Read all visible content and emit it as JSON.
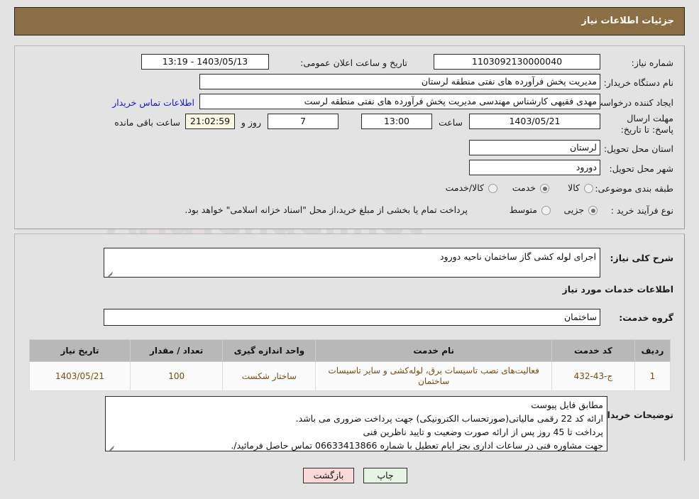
{
  "header": {
    "title": "جزئیات اطلاعات نیاز"
  },
  "main_form": {
    "need_number_label": "شماره نیاز:",
    "need_number_value": "1103092130000040",
    "announce_label": "تاریخ و ساعت اعلان عمومی:",
    "announce_value": "1403/05/13 - 13:19",
    "buyer_org_label": "نام دستگاه خریدار:",
    "buyer_org_value": "مدیریت پخش فرآورده های نفتی منطقه لرستان",
    "requester_label": "ایجاد کننده درخواست:",
    "requester_value": "مهدی فقیهی کارشناس مهندسی مدیریت پخش فرآورده های نفتی منطقه لرست",
    "contact_link": "اطلاعات تماس خریدار",
    "deadline_label": "مهلت ارسال پاسخ: تا تاریخ:",
    "deadline_date": "1403/05/21",
    "hour_label": "ساعت",
    "deadline_time": "13:00",
    "days_remaining": "7",
    "days_word": "روز و",
    "time_remaining": "21:02:59",
    "remaining_suffix": "ساعت باقی مانده",
    "province_label": "استان محل تحویل:",
    "province_value": "لرستان",
    "city_label": "شهر محل تحویل:",
    "city_value": "دورود",
    "category_label": "طبقه بندی موضوعی:",
    "category_options": [
      {
        "label": "کالا",
        "selected": false
      },
      {
        "label": "خدمت",
        "selected": true
      },
      {
        "label": "کالا/خدمت",
        "selected": false
      }
    ],
    "process_label": "نوع فرآیند خرید :",
    "process_options": [
      {
        "label": "جزیی",
        "selected": true
      },
      {
        "label": "متوسط",
        "selected": false
      }
    ],
    "payment_note": "پرداخت تمام یا بخشی از مبلغ خرید،از محل \"اسناد خزانه اسلامی\" خواهد بود."
  },
  "detail": {
    "general_desc_label": "شرح کلی نیاز:",
    "general_desc_value": "اجرای لوله کشی گاز ساختمان ناحیه دورود",
    "services_section_title": "اطلاعات خدمات مورد نیاز",
    "service_group_label": "گروه خدمت:",
    "service_group_value": "ساختمان",
    "buyer_notes_label": "توضیحات خریدار:",
    "buyer_notes_lines": [
      "مطابق فایل پیوست",
      "ارائه کد 22 رقمی مالیاتی(صورتحساب الکترونیکی) جهت پرداخت ضروری می باشد.",
      "پرداخت تا 45 روز پس از ارائه صورت وضعیت و تایید ناظرین فنی",
      "جهت مشاوره فنی در ساعات اداری بجز ایام تعطیل با شماره 06633413866 تماس حاصل فرمائید/."
    ]
  },
  "items_table": {
    "columns": [
      "ردیف",
      "کد خدمت",
      "نام خدمت",
      "واحد اندازه گیری",
      "تعداد / مقدار",
      "تاریخ نیاز"
    ],
    "rows": [
      {
        "row_no": "1",
        "service_code": "ج-43-432",
        "service_name": "فعالیت‌های نصب تاسیسات برق، لوله‌کشی و سایر تاسیسات ساختمان",
        "unit": "ساختار شکست",
        "quantity": "100",
        "need_date": "1403/05/21"
      }
    ]
  },
  "footer": {
    "print_label": "چاپ",
    "back_label": "بازگشت"
  },
  "watermark": {
    "text": "AriaTender.net"
  },
  "colors": {
    "header_brown": "#8b6e43",
    "page_bg": "#e3e3e3",
    "link_blue": "#1515dd",
    "table_header": "#b8b8b8",
    "table_text": "#7c4a12",
    "print_green": "#e6f5e3",
    "back_pink": "#fbd9d9"
  }
}
